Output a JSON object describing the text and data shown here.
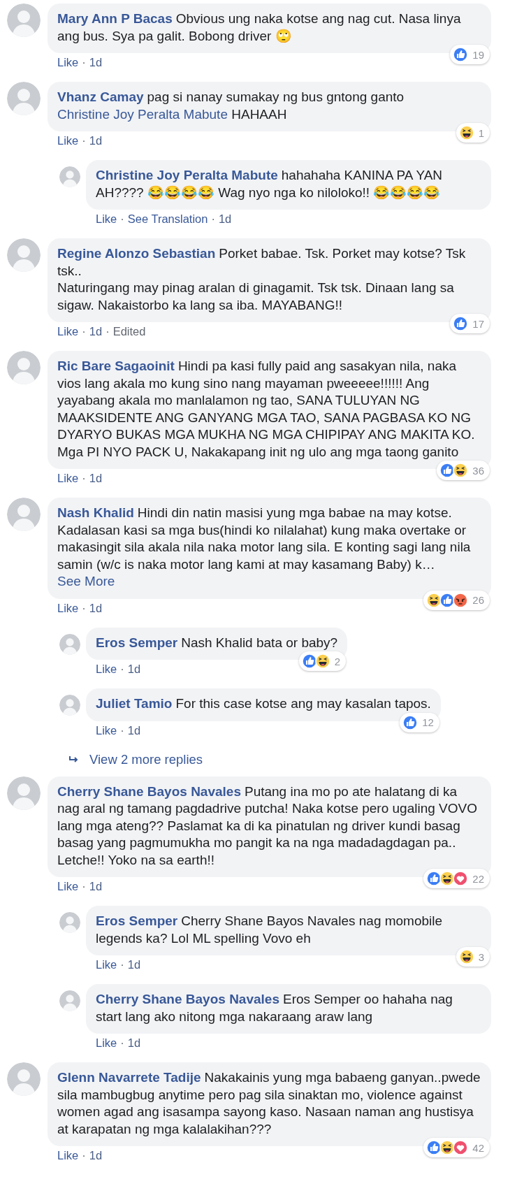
{
  "comments": [
    {
      "author": "Mary Ann P Bacas",
      "parts": [
        {
          "kind": "text",
          "text": "Obvious ung naka kotse ang nag cut. Nasa linya ang bus. Sya pa galit. Bobong driver 🙄"
        }
      ],
      "reactions": [
        {
          "kind": "like"
        }
      ],
      "reaction_count": "19",
      "meta": [
        {
          "kind": "link",
          "text": "Like"
        },
        {
          "kind": "dot",
          "text": "·"
        },
        {
          "kind": "time",
          "text": "1d"
        }
      ]
    },
    {
      "author": "Vhanz Camay",
      "parts": [
        {
          "kind": "text",
          "text": "pag si nanay sumakay ng bus gntong ganto "
        },
        {
          "kind": "mention",
          "text": "Christine Joy Peralta Mabute"
        },
        {
          "kind": "text",
          "text": " HAHAAH"
        }
      ],
      "reactions": [
        {
          "kind": "haha"
        }
      ],
      "reaction_count": "1",
      "meta": [
        {
          "kind": "link",
          "text": "Like"
        },
        {
          "kind": "dot",
          "text": "·"
        },
        {
          "kind": "time",
          "text": "1d"
        }
      ],
      "replies": [
        {
          "author": "Christine Joy Peralta Mabute",
          "parts": [
            {
              "kind": "text",
              "text": "hahahaha KANINA PA YAN AH???? 😂😂😂😂 Wag nyo nga ko niloloko!! 😂😂😂😂"
            }
          ],
          "meta": [
            {
              "kind": "link",
              "text": "Like"
            },
            {
              "kind": "dot",
              "text": "·"
            },
            {
              "kind": "link",
              "text": "See Translation"
            },
            {
              "kind": "dot",
              "text": "·"
            },
            {
              "kind": "time",
              "text": "1d"
            }
          ]
        }
      ]
    },
    {
      "author": "Regine Alonzo Sebastian",
      "parts": [
        {
          "kind": "text",
          "text": "Porket babae. Tsk. Porket may kotse? Tsk tsk..\nNaturingang may pinag aralan di ginagamit. Tsk tsk. Dinaan lang sa sigaw. Nakaistorbo ka lang sa iba. MAYABANG!!"
        }
      ],
      "reactions": [
        {
          "kind": "like"
        }
      ],
      "reaction_count": "17",
      "meta": [
        {
          "kind": "link",
          "text": "Like"
        },
        {
          "kind": "dot",
          "text": "·"
        },
        {
          "kind": "time",
          "text": "1d"
        },
        {
          "kind": "dot",
          "text": "·"
        },
        {
          "kind": "plain",
          "text": "Edited"
        }
      ]
    },
    {
      "author": "Ric Bare Sagaoinit",
      "parts": [
        {
          "kind": "text",
          "text": "Hindi pa kasi fully paid ang sasakyan nila, naka vios lang akala mo kung sino nang mayaman pweeeee!!!!!! Ang yayabang akala mo manlalamon ng tao, SANA TULUYAN NG MAAKSIDENTE ANG GANYANG MGA TAO, SANA PAGBASA KO NG DYARYO BUKAS MGA MUKHA NG MGA CHIPIPAY ANG MAKITA KO. Mga PI NYO PACK U, Nakakapang init ng ulo ang mga taong ganito"
        }
      ],
      "reactions": [
        {
          "kind": "like"
        },
        {
          "kind": "haha"
        }
      ],
      "reaction_count": "36",
      "meta": [
        {
          "kind": "link",
          "text": "Like"
        },
        {
          "kind": "dot",
          "text": "·"
        },
        {
          "kind": "time",
          "text": "1d"
        }
      ]
    },
    {
      "author": "Nash Khalid",
      "parts": [
        {
          "kind": "text",
          "text": "Hindi din natin masisi yung mga babae na may kotse. Kadalasan kasi sa mga bus(hindi ko nilalahat) kung maka overtake or makasingit sila akala nila naka motor lang sila. E konting sagi lang nila samin (w/c is naka motor lang kami at may kasamang Baby) k… "
        },
        {
          "kind": "link",
          "text": "See More"
        }
      ],
      "reactions": [
        {
          "kind": "haha"
        },
        {
          "kind": "like"
        },
        {
          "kind": "angry"
        }
      ],
      "reaction_count": "26",
      "meta": [
        {
          "kind": "link",
          "text": "Like"
        },
        {
          "kind": "dot",
          "text": "·"
        },
        {
          "kind": "time",
          "text": "1d"
        }
      ],
      "replies": [
        {
          "author": "Eros Semper",
          "parts": [
            {
              "kind": "text",
              "text": "Nash Khalid bata or baby?"
            }
          ],
          "reactions": [
            {
              "kind": "like"
            },
            {
              "kind": "haha"
            }
          ],
          "reaction_count": "2",
          "meta": [
            {
              "kind": "link",
              "text": "Like"
            },
            {
              "kind": "dot",
              "text": "·"
            },
            {
              "kind": "time",
              "text": "1d"
            }
          ]
        },
        {
          "author": "Juliet Tamio",
          "parts": [
            {
              "kind": "text",
              "text": "For this case kotse ang may kasalan tapos."
            }
          ],
          "reactions": [
            {
              "kind": "like"
            }
          ],
          "reaction_count": "12",
          "meta": [
            {
              "kind": "link",
              "text": "Like"
            },
            {
              "kind": "dot",
              "text": "·"
            },
            {
              "kind": "time",
              "text": "1d"
            }
          ]
        }
      ],
      "more_replies": "View 2 more replies"
    },
    {
      "author": "Cherry Shane Bayos Navales",
      "parts": [
        {
          "kind": "text",
          "text": "Putang ina mo po ate halatang di ka nag aral ng tamang pagdadrive putcha! Naka kotse pero ugaling VOVO lang mga ateng?? Paslamat ka di ka pinatulan ng driver kundi basag basag yang pagmumukha mo pangit ka na nga madadagdagan pa.. Letche!! Yoko na sa earth!!"
        }
      ],
      "reactions": [
        {
          "kind": "like"
        },
        {
          "kind": "haha"
        },
        {
          "kind": "love"
        }
      ],
      "reaction_count": "22",
      "meta": [
        {
          "kind": "link",
          "text": "Like"
        },
        {
          "kind": "dot",
          "text": "·"
        },
        {
          "kind": "time",
          "text": "1d"
        }
      ],
      "replies": [
        {
          "author": "Eros Semper",
          "parts": [
            {
              "kind": "text",
              "text": "Cherry Shane Bayos Navales nag momobile legends ka? Lol ML spelling Vovo eh"
            }
          ],
          "reactions": [
            {
              "kind": "haha"
            }
          ],
          "reaction_count": "3",
          "meta": [
            {
              "kind": "link",
              "text": "Like"
            },
            {
              "kind": "dot",
              "text": "·"
            },
            {
              "kind": "time",
              "text": "1d"
            }
          ]
        },
        {
          "author": "Cherry Shane Bayos Navales",
          "parts": [
            {
              "kind": "text",
              "text": "Eros Semper oo hahaha nag start lang ako nitong mga nakaraang araw lang"
            }
          ],
          "meta": [
            {
              "kind": "link",
              "text": "Like"
            },
            {
              "kind": "dot",
              "text": "·"
            },
            {
              "kind": "time",
              "text": "1d"
            }
          ]
        }
      ]
    },
    {
      "author": "Glenn Navarrete Tadije",
      "parts": [
        {
          "kind": "text",
          "text": "Nakakainis yung mga babaeng ganyan..pwede sila mambugbug anytime pero pag sila sinaktan mo, violence against women agad ang isasampa sayong kaso. Nasaan naman ang hustisya at karapatan ng mga kalalakihan???"
        }
      ],
      "reactions": [
        {
          "kind": "like"
        },
        {
          "kind": "haha"
        },
        {
          "kind": "love"
        }
      ],
      "reaction_count": "42",
      "meta": [
        {
          "kind": "link",
          "text": "Like"
        },
        {
          "kind": "dot",
          "text": "·"
        },
        {
          "kind": "time",
          "text": "1d"
        }
      ]
    }
  ]
}
